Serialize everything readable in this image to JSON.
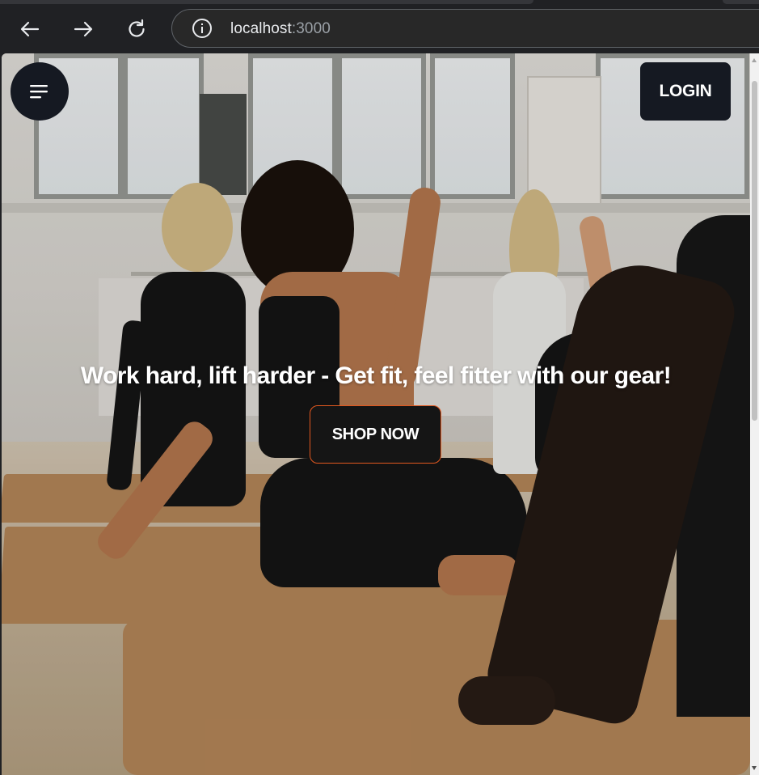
{
  "browser": {
    "url_host": "localhost",
    "url_port": ":3000",
    "icons": {
      "back": "arrow-left-icon",
      "forward": "arrow-right-icon",
      "reload": "reload-icon",
      "site_info": "info-icon"
    }
  },
  "header": {
    "menu_icon": "hamburger-menu-icon",
    "login_label": "LOGIN"
  },
  "hero": {
    "headline": "Work hard, lift harder - Get fit, feel fitter with our gear!",
    "cta_label": "SHOP NOW",
    "cta_border_color": "#e2581f",
    "button_bg_color": "#151922"
  }
}
